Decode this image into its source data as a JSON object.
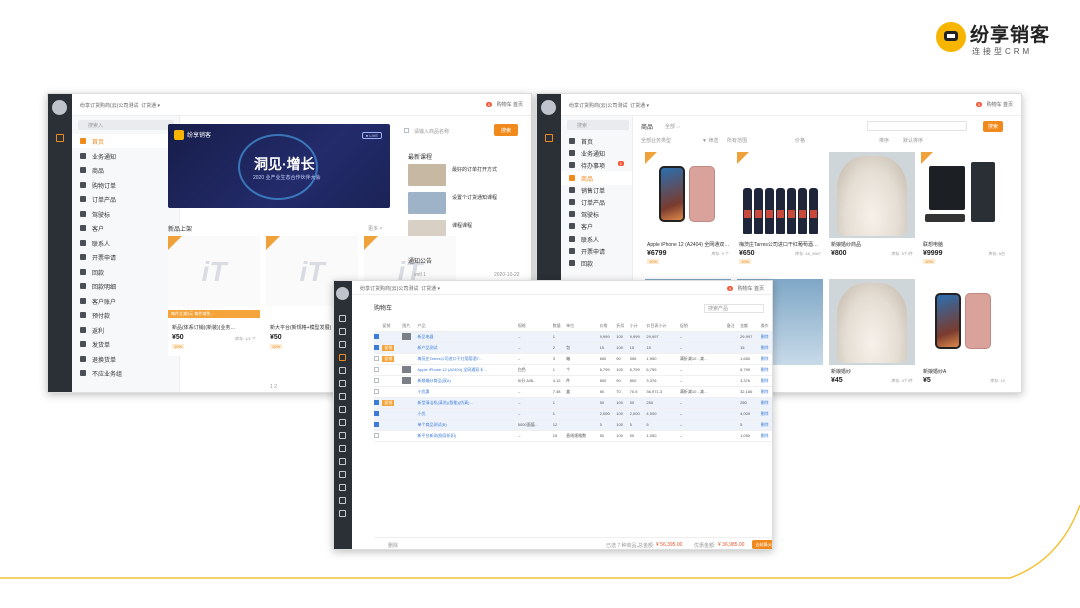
{
  "brand": {
    "name": "纷享销客",
    "sub": "连接型CRM"
  },
  "win1": {
    "company": "纷享订货购商(云)公司测试",
    "dropdown": "订货通",
    "topright": {
      "badge": "5",
      "cart": "购物车",
      "home": "首页"
    },
    "search_placeholder": "搜索入",
    "nav": [
      {
        "label": "首页",
        "active": true
      },
      {
        "label": "业务通知"
      },
      {
        "label": "商品"
      },
      {
        "label": "购物订单"
      },
      {
        "label": "订单产品"
      },
      {
        "label": "驾驶标"
      },
      {
        "label": "客户"
      },
      {
        "label": "联系人"
      },
      {
        "label": "开票申请"
      },
      {
        "label": "回款"
      },
      {
        "label": "回款明细"
      },
      {
        "label": "客户账户"
      },
      {
        "label": "预付款"
      },
      {
        "label": "返利"
      },
      {
        "label": "发货单"
      },
      {
        "label": "退换货单"
      },
      {
        "label": "不应业务组"
      }
    ],
    "banner": {
      "logo": "纷享销客",
      "title": "洞见·增长",
      "subtitle": "2020 业产业生态合作伙伴大会",
      "live": "● LIVE"
    },
    "notice_search": "请输入商品名称",
    "search_btn": "搜索",
    "new_section": {
      "title": "新品上架",
      "more": "更多 >"
    },
    "products": [
      {
        "name": "新品(体系订销)(新装)(业务…",
        "price": "¥50",
        "unit": "库存: 1/1 个",
        "tag": "10%",
        "strip": "每件立减3元 每件减免…"
      },
      {
        "name": "新大平台(新规格+模型发展)",
        "price": "¥50",
        "unit": "库存: 1/1 个",
        "tag": "10%",
        "strip": ""
      },
      {
        "name": "",
        "price": "",
        "unit": "",
        "tag": "",
        "strip": ""
      }
    ],
    "courses_title": "最新课程",
    "courses": [
      {
        "name": "最好的订单打开方式"
      },
      {
        "name": "设置个订货通知课程"
      },
      {
        "name": "课程课程"
      }
    ],
    "notice_title": "通知公告",
    "notice_item": "vntl 1",
    "notice_date": "2020-10-22",
    "pager": "1 2"
  },
  "win2": {
    "company": "纷享订货购商(云)公司测试",
    "dropdown": "订货通",
    "topright": {
      "badge": "5",
      "cart": "购物车",
      "home": "首页"
    },
    "search_placeholder": "搜索",
    "nav": [
      {
        "label": "首页"
      },
      {
        "label": "业务通知"
      },
      {
        "label": "待办事项",
        "badge": "1"
      },
      {
        "label": "商品",
        "active": true
      },
      {
        "label": "销售订单"
      },
      {
        "label": "订单产品"
      },
      {
        "label": "驾驶标"
      },
      {
        "label": "客户"
      },
      {
        "label": "联系人"
      },
      {
        "label": "开票申请"
      },
      {
        "label": "回款"
      }
    ],
    "tabs": {
      "goods": "商品",
      "all": "全部"
    },
    "search_btn": "搜索",
    "filter": {
      "category": "全部业务类型",
      "filter": "筛选",
      "all": "所有范围",
      "sort": "排序",
      "price_label": "价格",
      "range": "默认排序"
    },
    "goods": [
      {
        "name": "Apple iPhone 12 (A2404) 全网通双…",
        "price": "¥6799",
        "unit": "库存: 9 个",
        "tag": "10%",
        "img": "phone"
      },
      {
        "name": "梅茨庄Tarres公司进口干红葡萄酒…",
        "price": "¥650",
        "unit": "库存: 48_9567",
        "tag": "10%",
        "img": "wine"
      },
      {
        "name": "新娘婚纱商品",
        "price": "¥800",
        "unit": "库存: 5个/件",
        "tag": "",
        "img": "dress"
      },
      {
        "name": "联想电脑",
        "price": "¥9999",
        "unit": "库存: 5台",
        "tag": "10%",
        "img": "pc"
      },
      {
        "name": "",
        "price": "",
        "unit": "",
        "tag": "",
        "img": "shell"
      },
      {
        "name": "",
        "price": "",
        "unit": "",
        "tag": "",
        "img": "shell"
      },
      {
        "name": "新娘婚纱",
        "price": "¥45",
        "unit": "库存: 4个/件",
        "tag": "",
        "img": "dress"
      },
      {
        "name": "新娘婚纱A",
        "price": "¥5",
        "unit": "库存: 10",
        "tag": "",
        "img": "phone"
      }
    ]
  },
  "win3": {
    "company": "纷享订货购商(云)公司测试",
    "dropdown": "订货通",
    "topright": {
      "badge": "5",
      "cart": "购物车",
      "home": "首页"
    },
    "title": "购物车",
    "search_placeholder": "搜索产品",
    "headers": [
      "",
      "促销",
      "图片",
      "产品",
      "规格",
      "数量",
      "单位",
      "价格",
      "折扣",
      "小计",
      "价目表小计",
      "促销",
      "备注",
      "金额",
      "操作"
    ],
    "rows": [
      {
        "sel": true,
        "promo": "",
        "thumb": true,
        "name": "新品电器",
        "spec": "--",
        "qty": "1",
        "unit": "",
        "price": "9,999",
        "disc": "100",
        "sub": "9,999",
        "list": "29,997",
        "p": "--",
        "note": "",
        "amt": "29,997",
        "op": "删除"
      },
      {
        "sel": true,
        "promo": "促销",
        "thumb": false,
        "name": "新产品测试",
        "spec": "--",
        "qty": "2",
        "unit": "包",
        "price": "15",
        "disc": "100",
        "sub": "15",
        "list": "15",
        "p": "--",
        "note": "",
        "amt": "15",
        "op": "删除"
      },
      {
        "sel": false,
        "promo": "促销",
        "thumb": false,
        "name": "梅茨庄Tarres公司进口干红葡萄酒7…",
        "spec": "--",
        "qty": "3",
        "unit": "箱",
        "price": "650",
        "disc": "90",
        "sub": "555",
        "list": "1,950",
        "p": "满折减10 - 减…",
        "note": "",
        "amt": "1,650",
        "op": "删除"
      },
      {
        "sel": false,
        "promo": "",
        "thumb": true,
        "name": "Apple iPhone 12 (A2404) 全网通双卡…",
        "spec": "白色",
        "qty": "1",
        "unit": "个",
        "price": "6,799",
        "disc": "100",
        "sub": "6,799",
        "list": "6,799",
        "p": "--",
        "note": "",
        "amt": "6,799",
        "op": "删除"
      },
      {
        "sel": false,
        "promo": "",
        "thumb": true,
        "name": "新娘婚纱商品(双A)",
        "spec": "5/分 A/5L",
        "qty": "4.12",
        "unit": "件",
        "price": "800",
        "disc": "90",
        "sub": "800",
        "list": "3,376",
        "p": "--",
        "note": "",
        "amt": "3,376",
        "op": "删除"
      },
      {
        "sel": false,
        "promo": "",
        "thumb": false,
        "name": "小优惠",
        "spec": "--",
        "qty": "7.48",
        "unit": "盒",
        "price": "80",
        "disc": "70",
        "sub": "70.5",
        "list": "36,971.3",
        "p": "满折减10 - 减…",
        "note": "",
        "amt": "32,166",
        "op": "删除"
      },
      {
        "sel": true,
        "promo": "促销",
        "thumb": false,
        "name": "新型清洁机(清洗)(智能)(仿真)…",
        "spec": "--",
        "qty": "1",
        "unit": "",
        "price": "50",
        "disc": "100",
        "sub": "50",
        "list": "250",
        "p": "--",
        "note": "",
        "amt": "250",
        "op": "删除"
      },
      {
        "sel": true,
        "promo": "",
        "thumb": false,
        "name": "小优",
        "spec": "--",
        "qty": "1",
        "unit": "",
        "price": "2,000",
        "disc": "100",
        "sub": "2,000",
        "list": "4,000",
        "p": "--",
        "note": "",
        "amt": "4,000",
        "op": "删除"
      },
      {
        "sel": true,
        "promo": "",
        "thumb": false,
        "name": "单个商品测试(B)",
        "spec": "5000面值…",
        "qty": "12",
        "unit": "",
        "price": "5",
        "disc": "100",
        "sub": "5",
        "list": "5",
        "p": "--",
        "note": "",
        "amt": "5",
        "op": "删除"
      },
      {
        "sel": false,
        "promo": "",
        "thumb": false,
        "name": "新平台新测(指导折扣)",
        "spec": "--",
        "qty": "15",
        "unit": "直线规格数",
        "price": "50",
        "disc": "100",
        "sub": "50",
        "list": "1,050",
        "p": "--",
        "note": "",
        "amt": "1,050",
        "op": "删除"
      }
    ],
    "footer": {
      "delete": "删除",
      "selected": "已选 7 种商品，",
      "total_label": "总金额:",
      "total": "¥ 56,395.00",
      "discount_label": "优惠金额:",
      "discount": "¥ 36,985.00",
      "settle": "去结算(6)"
    }
  }
}
